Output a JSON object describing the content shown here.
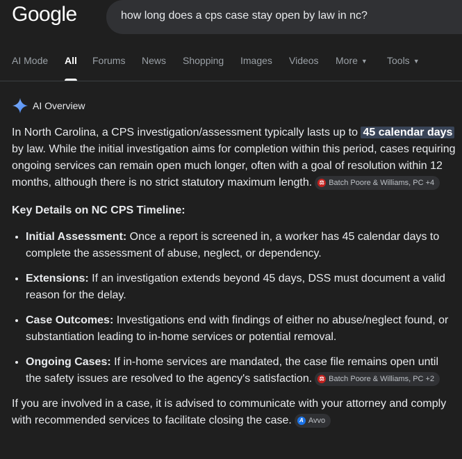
{
  "header": {
    "logo": "Google",
    "search_query": "how long does a cps case stay open by law in nc?"
  },
  "tabs": [
    {
      "label": "AI Mode"
    },
    {
      "label": "All"
    },
    {
      "label": "Forums"
    },
    {
      "label": "News"
    },
    {
      "label": "Shopping"
    },
    {
      "label": "Images"
    },
    {
      "label": "Videos"
    },
    {
      "label": "More"
    },
    {
      "label": "Tools"
    }
  ],
  "ai_overview": {
    "title": "AI Overview",
    "intro_before": "In North Carolina, a CPS investigation/assessment typically lasts up to ",
    "highlight": "45 calendar days",
    "intro_after": " by law. While the initial investigation aims for completion within this period, cases requiring ongoing services can remain open much longer, often with a goal of resolution within 12 months, although there is no strict statutory maximum length.",
    "source1": "Batch Poore & Williams, PC +4",
    "key_details_heading": "Key Details on NC CPS Timeline:",
    "bullets": [
      {
        "title": "Initial Assessment:",
        "text": " Once a report is screened in, a worker has 45 calendar days to complete the assessment of abuse, neglect, or dependency."
      },
      {
        "title": "Extensions:",
        "text": " If an investigation extends beyond 45 days, DSS must document a valid reason for the delay."
      },
      {
        "title": "Case Outcomes:",
        "text": " Investigations end with findings of either no abuse/neglect found, or substantiation leading to in-home services or potential removal."
      },
      {
        "title": "Ongoing Cases:",
        "text": " If in-home services are mandated, the case file remains open until the safety issues are resolved to the agency's satisfaction.",
        "source": "Batch Poore & Williams, PC +2"
      }
    ],
    "closing": "If you are involved in a case, it is advised to communicate with your attorney and comply with recommended services to facilitate closing the case.",
    "closing_source": "Avvo"
  },
  "colors": {
    "background": "#1f1f1f",
    "highlight_bg": "#394457",
    "chip_bg": "#303134",
    "sparkle": "#4285f4"
  }
}
